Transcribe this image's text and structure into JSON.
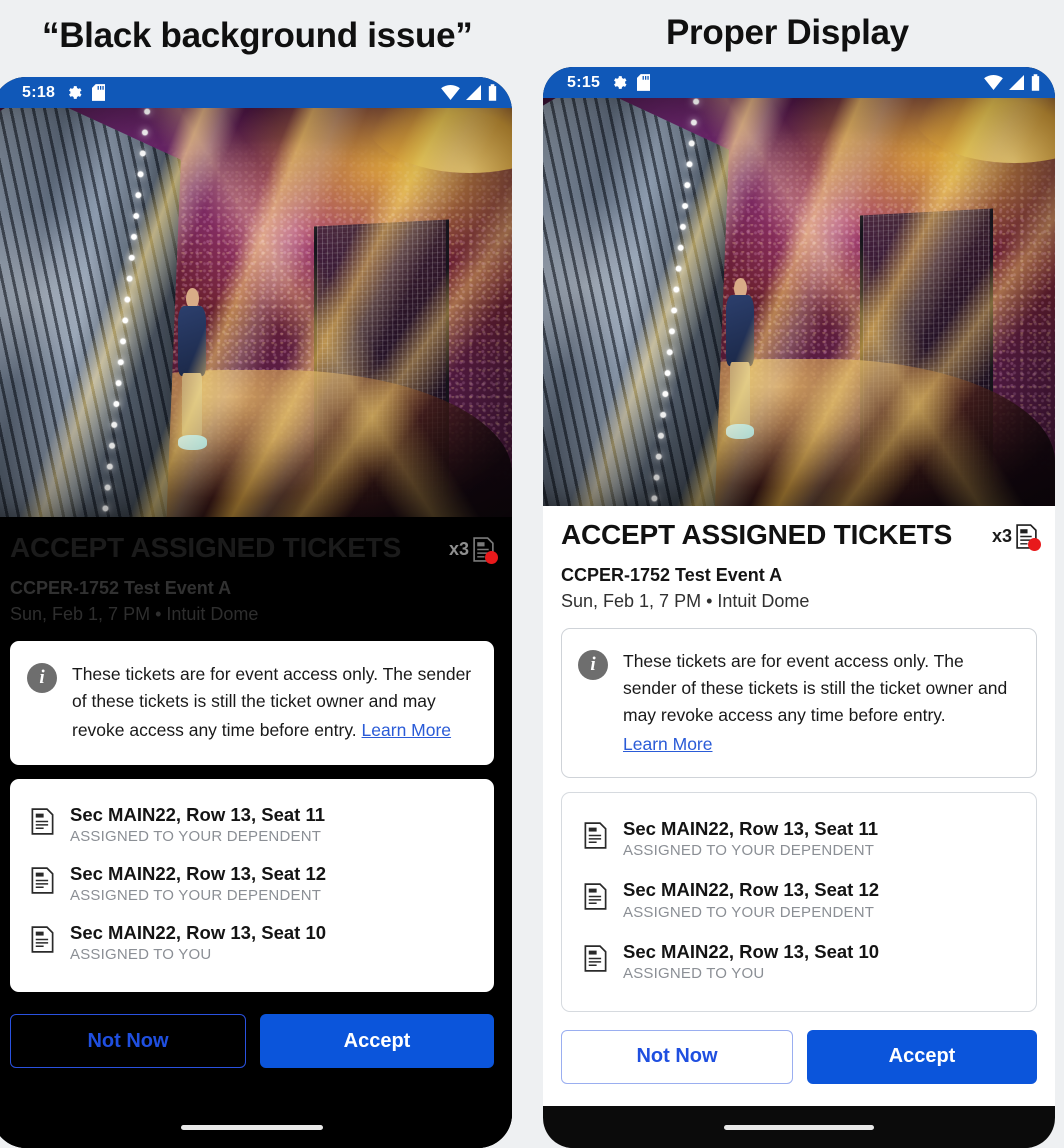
{
  "captions": {
    "left": "“Black background issue”",
    "right": "Proper Display"
  },
  "colors": {
    "status_bar_blue": "#1058b8",
    "primary_button_blue": "#0b55db",
    "link_blue": "#2a5bd7",
    "badge_red": "#e8191b",
    "page_background": "#eef0f2",
    "left_screen_background": "#000000",
    "right_screen_background": "#ffffff"
  },
  "left_phone": {
    "status_bar": {
      "time": "5:18",
      "icons": [
        "gear-icon",
        "sd-card-icon",
        "wifi-icon",
        "cellular-signal-icon",
        "battery-icon"
      ]
    },
    "screen": {
      "title": "ACCEPT ASSIGNED TICKETS",
      "count": "x3",
      "badge_icon": "ticket-document-icon",
      "event_name": "CCPER-1752 Test Event A",
      "event_meta": "Sun, Feb 1, 7 PM • Intuit Dome",
      "info": {
        "icon": "info-icon",
        "text": "These tickets are for event access only. The sender of these tickets is still the ticket owner and may revoke access any time before entry.",
        "link": "Learn More"
      },
      "tickets": [
        {
          "seat": "Sec MAIN22, Row 13, Seat 11",
          "assigned": "ASSIGNED TO YOUR DEPENDENT"
        },
        {
          "seat": "Sec MAIN22, Row 13, Seat 12",
          "assigned": "ASSIGNED TO YOUR DEPENDENT"
        },
        {
          "seat": "Sec MAIN22, Row 13, Seat 10",
          "assigned": "ASSIGNED TO YOU"
        }
      ],
      "buttons": {
        "secondary": "Not Now",
        "primary": "Accept"
      }
    }
  },
  "right_phone": {
    "status_bar": {
      "time": "5:15",
      "icons": [
        "gear-icon",
        "sd-card-icon",
        "wifi-icon",
        "cellular-signal-icon",
        "battery-icon"
      ]
    },
    "screen": {
      "title": "ACCEPT ASSIGNED TICKETS",
      "count": "x3",
      "badge_icon": "ticket-document-icon",
      "event_name": "CCPER-1752 Test Event A",
      "event_meta": "Sun, Feb 1, 7 PM • Intuit Dome",
      "info": {
        "icon": "info-icon",
        "text": "These tickets are for event access only. The sender of these tickets is still the ticket owner and may revoke access any time before entry.",
        "link": "Learn More"
      },
      "tickets": [
        {
          "seat": "Sec MAIN22, Row 13, Seat 11",
          "assigned": "ASSIGNED TO YOUR DEPENDENT"
        },
        {
          "seat": "Sec MAIN22, Row 13, Seat 12",
          "assigned": "ASSIGNED TO YOUR DEPENDENT"
        },
        {
          "seat": "Sec MAIN22, Row 13, Seat 10",
          "assigned": "ASSIGNED TO YOU"
        }
      ],
      "buttons": {
        "secondary": "Not Now",
        "primary": "Accept"
      }
    }
  }
}
